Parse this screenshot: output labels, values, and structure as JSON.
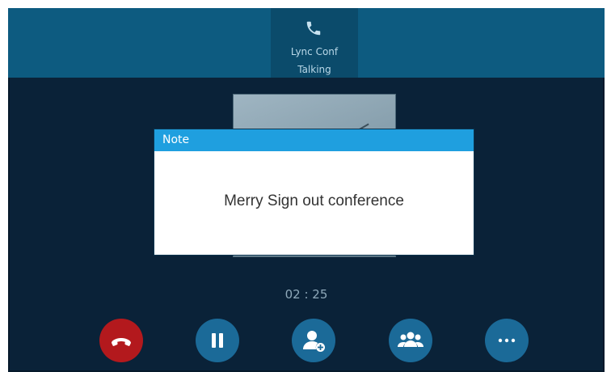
{
  "call_tab": {
    "name": "Lync Conf",
    "status": "Talking",
    "icon": "phone-icon"
  },
  "dialog": {
    "title": "Note",
    "message": "Merry Sign out conference"
  },
  "timer": "02 : 25",
  "controls": [
    {
      "icon": "end-call-icon",
      "color": "#b3191d"
    },
    {
      "icon": "hold-icon",
      "color": "#1b6a98"
    },
    {
      "icon": "add-participant-icon",
      "color": "#1b6a98"
    },
    {
      "icon": "participants-icon",
      "color": "#1b6a98"
    },
    {
      "icon": "more-icon",
      "color": "#1b6a98"
    }
  ],
  "colors": {
    "background": "#0a2238",
    "topbar": "#0d5b80",
    "dialog_title_bar": "#1f9fdf",
    "button": "#1b6a98",
    "end_call": "#b3191d"
  }
}
